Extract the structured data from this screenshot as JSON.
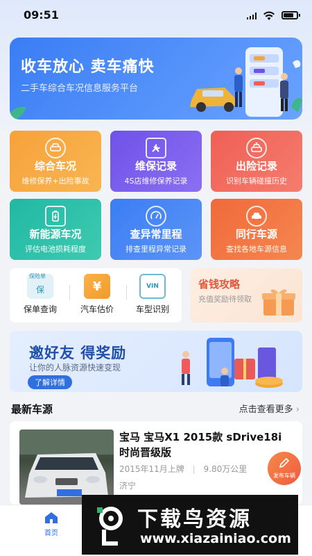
{
  "status": {
    "time": "09:51"
  },
  "banner": {
    "headline": "收车放心 卖车痛快",
    "subline": "二手车综合车况信息服务平台"
  },
  "services": [
    {
      "title": "综合车况",
      "sub": "维修保养+出险事故",
      "icon": "car-report-icon",
      "color": "#f7a23a"
    },
    {
      "title": "维保记录",
      "sub": "4S店维修保养记录",
      "icon": "wrench-icon",
      "color": "#6f52e8"
    },
    {
      "title": "出险记录",
      "sub": "识别车辆碰撞历史",
      "icon": "car-crash-icon",
      "color": "#ef5f55"
    },
    {
      "title": "新能源车况",
      "sub": "评估电池损耗程度",
      "icon": "battery-icon",
      "color": "#20b8a3"
    },
    {
      "title": "查异常里程",
      "sub": "排查里程异常记录",
      "icon": "speedometer-icon",
      "color": "#3a7df4"
    },
    {
      "title": "同行车源",
      "sub": "查找各地车源信息",
      "icon": "car-icon",
      "color": "#f06a3a"
    }
  ],
  "tools": [
    {
      "label": "保单查询",
      "icon": "policy-icon",
      "badge": "保险单",
      "badge2": "保"
    },
    {
      "label": "汽车估价",
      "icon": "yuan-icon",
      "badge": "¥"
    },
    {
      "label": "车型识别",
      "icon": "vin-scan-icon",
      "badge": "VIN"
    }
  ],
  "promo": {
    "title": "省钱攻略",
    "sub": "充值奖励待领取"
  },
  "invite": {
    "title": "邀好友  得奖励",
    "sub": "让你的人脉资源快速变现",
    "button": "了解详情"
  },
  "section": {
    "title": "最新车源",
    "more": "点击查看更多"
  },
  "listing": {
    "title": "宝马 宝马X1 2015款 sDrive18i 时尚晋级版",
    "date": "2015年11月上牌",
    "mileage": "9.80万公里",
    "separator": "|",
    "city": "济宁"
  },
  "fab": {
    "label": "发布车辆"
  },
  "tabbar": {
    "home": "首页"
  },
  "watermark": {
    "brand": "下载鸟资源",
    "url": "www.xiazainiao.com"
  }
}
